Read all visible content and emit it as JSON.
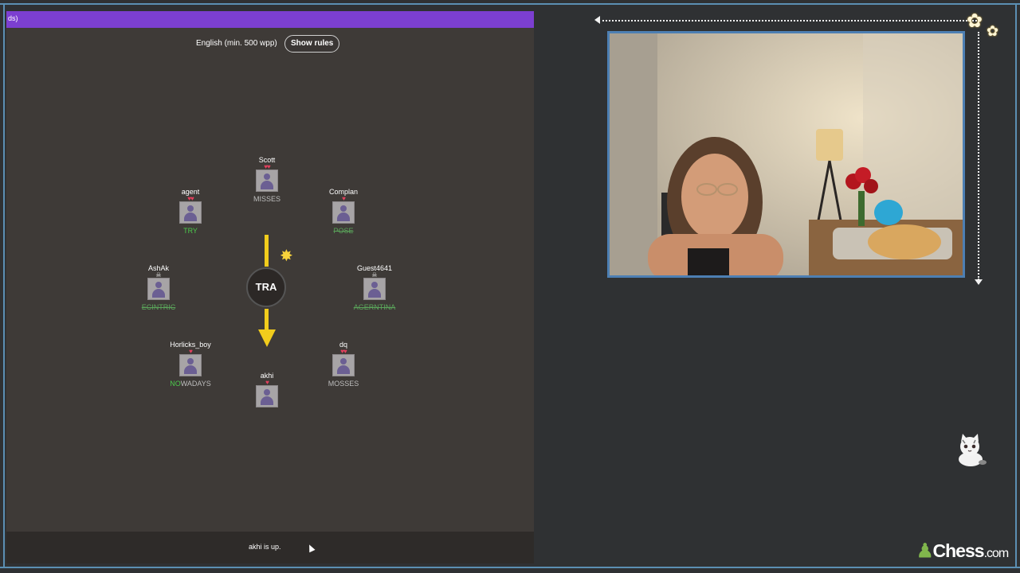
{
  "game": {
    "header_fragment": "ds)",
    "language_label": "English (min. 500 wpp)",
    "show_rules_label": "Show rules",
    "center_syllable": "TRA",
    "status_message": "akhi is up."
  },
  "players": [
    {
      "name": "Scott",
      "lives": "♥♥",
      "word_green": "",
      "word_rest": "MISSES",
      "struck": false
    },
    {
      "name": "agent",
      "lives": "♥♥",
      "word_green": "TRY",
      "word_rest": "",
      "struck": false
    },
    {
      "name": "Complan",
      "lives": "♥",
      "word_green": "",
      "word_rest": "POSE",
      "struck": true
    },
    {
      "name": "AshAk",
      "lives": "☠",
      "word_green": "",
      "word_rest": "ECINTRIC",
      "struck": true
    },
    {
      "name": "Guest4641",
      "lives": "☠",
      "word_green": "",
      "word_rest": "AGERNTINA",
      "struck": true
    },
    {
      "name": "Horlicks_boy",
      "lives": "♥",
      "word_green": "NO",
      "word_rest": "WADAYS",
      "struck": false
    },
    {
      "name": "dq",
      "lives": "♥♥",
      "word_green": "",
      "word_rest": "MOSSES",
      "struck": false
    },
    {
      "name": "akhi",
      "lives": "♥",
      "word_green": "",
      "word_rest": "",
      "struck": false
    }
  ],
  "brand": {
    "name": "Chess",
    "suffix": ".com"
  },
  "colors": {
    "accent_purple": "#7c3fd1",
    "arrow_yellow": "#f1cc1c",
    "frame_blue": "#4d7fb3"
  }
}
